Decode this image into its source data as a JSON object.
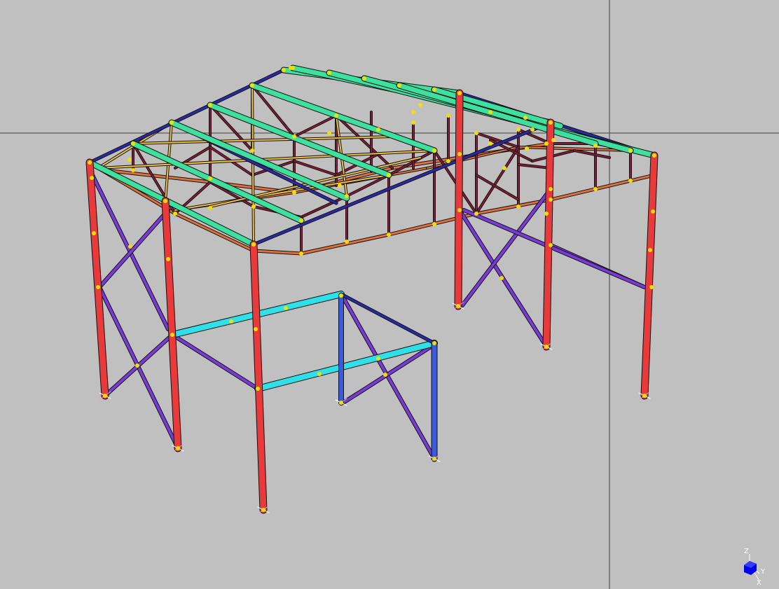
{
  "app": {
    "view": "3D model view"
  },
  "triad": {
    "z_label": "Z",
    "y_label": "Y",
    "x_label": "X"
  },
  "colors": {
    "background": "#c0c0c0",
    "columns": "#e83a3a",
    "rafters": "#2a2aa8",
    "purlins": "#3ee0a0",
    "braces": "#7a3ad8",
    "truss_webs": "#8a1a3a",
    "bottom_chords": "#e0703a",
    "roof_ties": "#f0c040",
    "mezzanine_beams": "#30e0e8",
    "mezzanine_posts": "#3a5ad8",
    "nodes": "#f0e000",
    "crosshair": "#404040"
  }
}
